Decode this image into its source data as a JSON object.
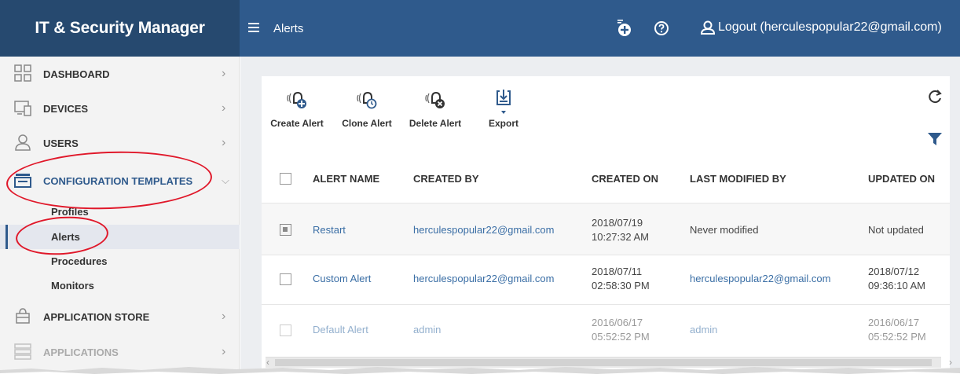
{
  "brand": "IT & Security Manager",
  "header": {
    "page_title": "Alerts",
    "logout_label": "Logout (herculespopular22@gmail.com)",
    "icons": [
      "menu-icon",
      "add-icon",
      "help-icon",
      "user-icon"
    ]
  },
  "sidebar": {
    "items": [
      {
        "label": "DASHBOARD",
        "icon": "dashboard-icon"
      },
      {
        "label": "DEVICES",
        "icon": "devices-icon"
      },
      {
        "label": "USERS",
        "icon": "user-icon"
      },
      {
        "label": "CONFIGURATION TEMPLATES",
        "icon": "templates-icon",
        "expanded": true
      },
      {
        "label": "APPLICATION STORE",
        "icon": "store-icon"
      },
      {
        "label": "APPLICATIONS",
        "icon": "applications-icon"
      }
    ],
    "sub_items": [
      {
        "label": "Profiles"
      },
      {
        "label": "Alerts",
        "active": true
      },
      {
        "label": "Procedures"
      },
      {
        "label": "Monitors"
      }
    ]
  },
  "toolbar": {
    "create": "Create Alert",
    "clone": "Clone Alert",
    "delete": "Delete Alert",
    "export": "Export"
  },
  "table": {
    "columns": [
      "ALERT NAME",
      "CREATED BY",
      "CREATED ON",
      "LAST MODIFIED BY",
      "UPDATED ON"
    ],
    "rows": [
      {
        "name": "Restart",
        "created_by": "herculespopular22@gmail.com",
        "created_on_date": "2018/07/19",
        "created_on_time": "10:27:32 AM",
        "modified_by": "Never modified",
        "updated": "Not updated",
        "updated_date": "",
        "updated_time": "",
        "selected": true
      },
      {
        "name": "Custom Alert",
        "created_by": "herculespopular22@gmail.com",
        "created_on_date": "2018/07/11",
        "created_on_time": "02:58:30 PM",
        "modified_by": "herculespopular22@gmail.com",
        "updated": "",
        "updated_date": "2018/07/12",
        "updated_time": "09:36:10 AM",
        "selected": false
      },
      {
        "name": "Default Alert",
        "created_by": "admin",
        "created_on_date": "2016/06/17",
        "created_on_time": "05:52:52 PM",
        "modified_by": "admin",
        "updated": "",
        "updated_date": "2016/06/17",
        "updated_time": "05:52:52 PM",
        "selected": false
      }
    ]
  },
  "colors": {
    "header": "#2f5a8c",
    "brand": "#26496f",
    "link": "#3a6ea5",
    "highlight_ring": "#e0182a"
  }
}
